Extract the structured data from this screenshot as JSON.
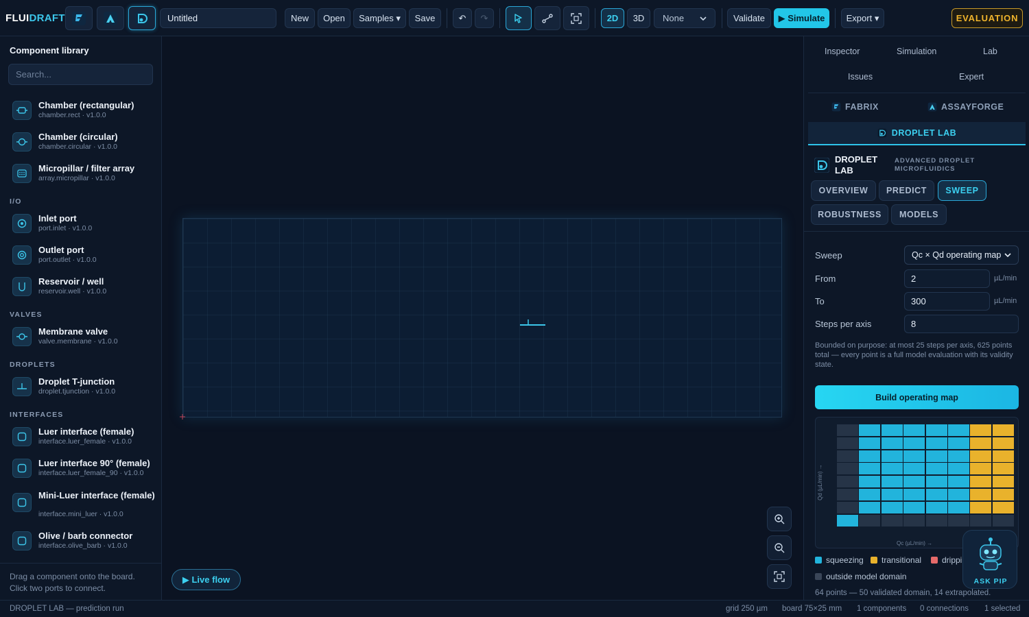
{
  "app": {
    "logo_main": "FLUI",
    "logo_accent": "DRAFT",
    "project_title": "Untitled"
  },
  "toolbar": {
    "new": "New",
    "open": "Open",
    "samples": "Samples ▾",
    "save": "Save",
    "undo": "↶",
    "redo": "↷",
    "view2d": "2D",
    "view3d": "3D",
    "overlay_select": "None",
    "validate": "Validate",
    "simulate": "▶ Simulate",
    "export": "Export ▾",
    "evaluation": "EVALUATION"
  },
  "left": {
    "title": "Component library",
    "search_placeholder": "Search...",
    "groups": {
      "io": "I/O",
      "valves": "VALVES",
      "droplets": "DROPLETS",
      "interfaces": "INTERFACES"
    },
    "components": [
      {
        "name": "Chamber (rectangular)",
        "id": "chamber.rect · v1.0.0",
        "icon": "chamber-rect-icon"
      },
      {
        "name": "Chamber (circular)",
        "id": "chamber.circular · v1.0.0",
        "icon": "chamber-circular-icon"
      },
      {
        "name": "Micropillar / filter array",
        "id": "array.micropillar · v1.0.0",
        "icon": "micropillar-icon"
      },
      {
        "name": "Inlet port",
        "id": "port.inlet · v1.0.0",
        "icon": "inlet-port-icon"
      },
      {
        "name": "Outlet port",
        "id": "port.outlet · v1.0.0",
        "icon": "outlet-port-icon"
      },
      {
        "name": "Reservoir / well",
        "id": "reservoir.well · v1.0.0",
        "icon": "reservoir-icon"
      },
      {
        "name": "Membrane valve",
        "id": "valve.membrane · v1.0.0",
        "icon": "valve-icon"
      },
      {
        "name": "Droplet T-junction",
        "id": "droplet.tjunction · v1.0.0",
        "icon": "tjunction-icon"
      },
      {
        "name": "Luer interface (female)",
        "id": "interface.luer_female · v1.0.0",
        "icon": "luer-icon"
      },
      {
        "name": "Luer interface 90° (female)",
        "id": "interface.luer_female_90 · v1.0.0",
        "icon": "luer90-icon"
      },
      {
        "name": "Mini-Luer interface (female)",
        "id": "interface.mini_luer · v1.0.0",
        "icon": "mini-luer-icon"
      },
      {
        "name": "Olive / barb connector",
        "id": "interface.olive_barb · v1.0.0",
        "icon": "barb-icon"
      }
    ],
    "hint_line1": "Drag a component onto the board.",
    "hint_line2": "Click two ports to connect."
  },
  "canvas": {
    "live_flow": "▶ Live flow"
  },
  "right": {
    "tabs": {
      "inspector": "Inspector",
      "simulation": "Simulation",
      "lab": "Lab",
      "issues": "Issues",
      "expert": "Expert"
    },
    "brands": {
      "fabrix": "FABRIX",
      "assayforge": "ASSAYFORGE",
      "droplet_lab": "DROPLET LAB"
    },
    "header_name": "DROPLET LAB",
    "header_sub": "ADVANCED DROPLET MICROFLUIDICS",
    "subtabs": {
      "overview": "OVERVIEW",
      "predict": "PREDICT",
      "sweep": "SWEEP",
      "robustness": "ROBUSTNESS",
      "models": "MODELS"
    },
    "form": {
      "sweep_label": "Sweep",
      "sweep_value": "Qc × Qd operating map",
      "from_label": "From",
      "from_value": "2",
      "to_label": "To",
      "to_value": "300",
      "steps_label": "Steps per axis",
      "steps_value": "8",
      "unit": "µL/min"
    },
    "note": "Bounded on purpose: at most 25 steps per axis, 625 points total — every point is a full model evaluation with its validity state.",
    "build_button": "Build operating map",
    "map": {
      "ylabel": "Qd (µL/min) →",
      "xlabel": "Qc (µL/min) →",
      "rows": [
        [
          "o",
          "s",
          "s",
          "s",
          "s",
          "s",
          "t",
          "t"
        ],
        [
          "o",
          "s",
          "s",
          "s",
          "s",
          "s",
          "t",
          "t"
        ],
        [
          "o",
          "s",
          "s",
          "s",
          "s",
          "s",
          "t",
          "t"
        ],
        [
          "o",
          "s",
          "s",
          "s",
          "s",
          "s",
          "t",
          "t"
        ],
        [
          "o",
          "s",
          "s",
          "s",
          "s",
          "s",
          "t",
          "t"
        ],
        [
          "o",
          "s",
          "s",
          "s",
          "s",
          "s",
          "t",
          "t"
        ],
        [
          "o",
          "s",
          "s",
          "s",
          "s",
          "s",
          "t",
          "t"
        ],
        [
          "s",
          "o",
          "o",
          "o",
          "o",
          "o",
          "o",
          "o"
        ]
      ]
    },
    "legend": {
      "squeezing": "squeezing",
      "transitional": "transitional",
      "dripping": "dripping",
      "outside": "outside model domain"
    },
    "colors": {
      "squeezing": "#22b4dc",
      "transitional": "#e9b22c",
      "dripping": "#e66a6a",
      "outside": "#263447"
    },
    "points_summary": "64 points — 50 validated domain, 14 extrapolated.",
    "pip_label": "ASK PIP"
  },
  "status": {
    "left": "DROPLET LAB — prediction run",
    "grid": "grid 250 µm",
    "board": "board 75×25 mm",
    "components": "1 components",
    "connections": "0 connections",
    "selected": "1 selected"
  }
}
